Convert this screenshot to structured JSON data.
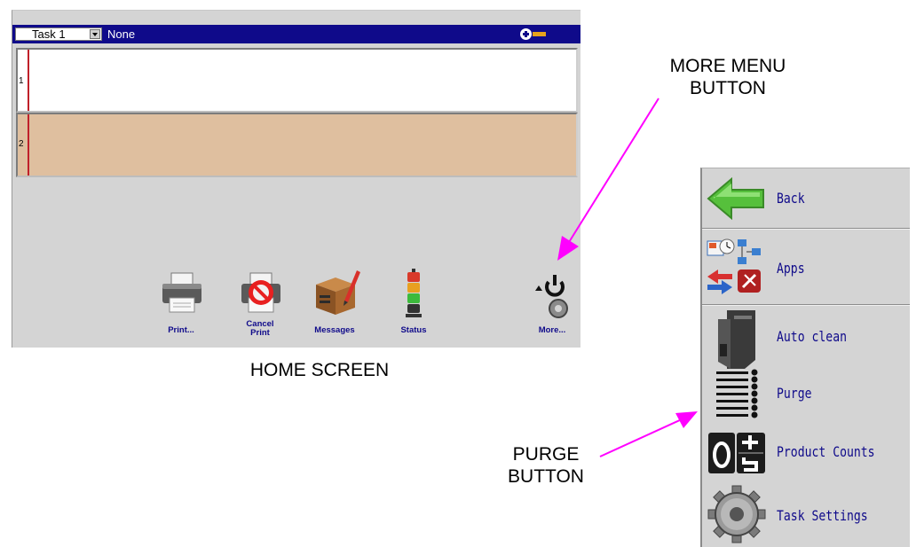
{
  "home_screen": {
    "task_select": {
      "value": "Task 1"
    },
    "message_name": "None",
    "zoom_icons": [
      "zoom-in-icon",
      "zoom-out-icon"
    ],
    "lines": [
      {
        "number": "1",
        "content": ""
      },
      {
        "number": "2",
        "content": ""
      }
    ],
    "toolbar": {
      "print_label": "Print...",
      "cancel_print_label_line1": "Cancel",
      "cancel_print_label_line2": "Print",
      "messages_label": "Messages",
      "status_label": "Status",
      "more_label": "More..."
    },
    "colors": {
      "task_bar": "#0f0a8a",
      "line1_bg": "#ffffff",
      "line2_bg": "#dfbf9f",
      "cursor": "#c0202a",
      "label_blue": "#0f0a8a"
    }
  },
  "annotations": {
    "home_screen_caption": "HOME SCREEN",
    "more_menu_line1": "MORE MENU",
    "more_menu_line2": "BUTTON",
    "purge_line1": "PURGE",
    "purge_line2": "BUTTON",
    "arrow_color": "#ff00ff"
  },
  "more_menu": {
    "items": [
      {
        "label": "Back",
        "icon": "back-arrow-icon"
      },
      {
        "label": "Apps",
        "icon": "apps-icon"
      },
      {
        "label": "Auto clean",
        "icon": "printhead-icon"
      },
      {
        "label": "Purge",
        "icon": "purge-icon"
      },
      {
        "label": "Product Counts",
        "icon": "counter-icon"
      },
      {
        "label": "Task Settings",
        "icon": "gear-icon"
      }
    ]
  }
}
